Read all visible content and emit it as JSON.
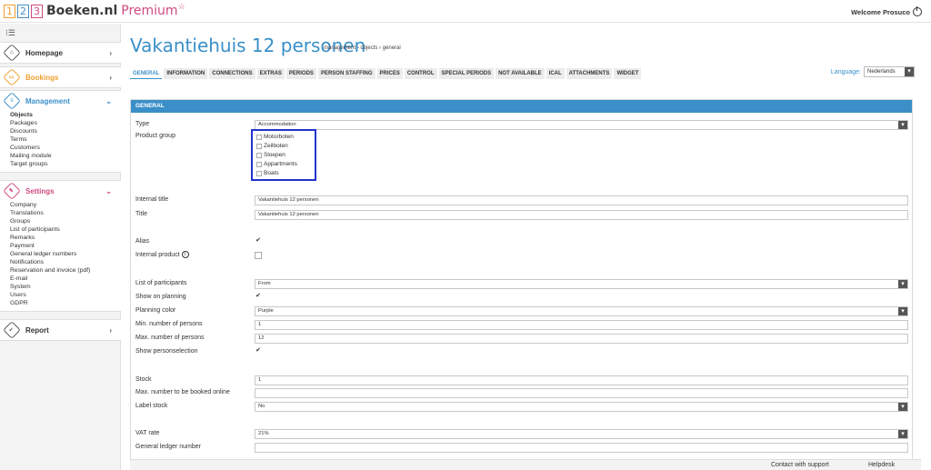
{
  "logo": {
    "n1": "1",
    "n2": "2",
    "n3": "3",
    "brand": "Boeken.nl",
    "premium": "Premium",
    "star": "☆"
  },
  "header": {
    "welcome": "Welcome Prosuco"
  },
  "sidebar": {
    "homepage": "Homepage",
    "bookings": "Bookings",
    "management": "Management",
    "management_items": [
      "Objects",
      "Packages",
      "Discounts",
      "Terms",
      "Customers",
      "Mailing module",
      "Target groups"
    ],
    "settings": "Settings",
    "settings_items": [
      "Company",
      "Translations",
      "Groups",
      "List of participants",
      "Remarks",
      "Payment",
      "General ledger numbers",
      "Notifications",
      "Reservation and invoice (pdf)",
      "E-mail",
      "System",
      "Users",
      "GDPR"
    ],
    "report": "Report"
  },
  "page": {
    "title": "Vakantiehuis 12 personen",
    "breadcrumb": "management › objects › general",
    "tabs": [
      "GENERAL",
      "INFORMATION",
      "CONNECTIONS",
      "EXTRAS",
      "PERIODS",
      "PERSON STAFFING",
      "PRICES",
      "CONTROL",
      "SPECIAL PERIODS",
      "NOT AVAILABLE",
      "ICAL",
      "ATTACHMENTS",
      "WIDGET"
    ],
    "language_label": "Language:",
    "language_value": "Nederlands"
  },
  "form": {
    "panel_title": "GENERAL",
    "type_label": "Type",
    "type_value": "Accommodation",
    "product_group_label": "Product group",
    "product_groups": [
      "Motorboten",
      "Zeilboten",
      "Sloepen",
      "Appartments",
      "Boats"
    ],
    "internal_title_label": "Internal title",
    "internal_title_value": "Vakantiehuis 12 personen",
    "title_label": "Title",
    "title_value": "Vakantiehuis 12 personen",
    "alias_label": "Alias",
    "internal_product_label": "Internal product",
    "list_participants_label": "List of participants",
    "list_participants_value": "From",
    "show_on_planning_label": "Show on planning",
    "planning_color_label": "Planning color",
    "planning_color_value": "Purple",
    "min_persons_label": "Min. number of persons",
    "min_persons_value": "1",
    "max_persons_label": "Max. number of persons",
    "max_persons_value": "12",
    "show_personselection_label": "Show personselection",
    "stock_label": "Stock",
    "stock_value": "1",
    "max_online_label": "Max. number to be booked online",
    "max_online_value": "",
    "label_stock_label": "Label stock",
    "label_stock_value": "No",
    "vat_label": "VAT rate",
    "vat_value": "21%",
    "ledger_label": "General ledger number",
    "ledger_value": "",
    "checkmark": "✔"
  },
  "footer": {
    "contact": "Contact with support",
    "helpdesk": "Helpdesk"
  }
}
